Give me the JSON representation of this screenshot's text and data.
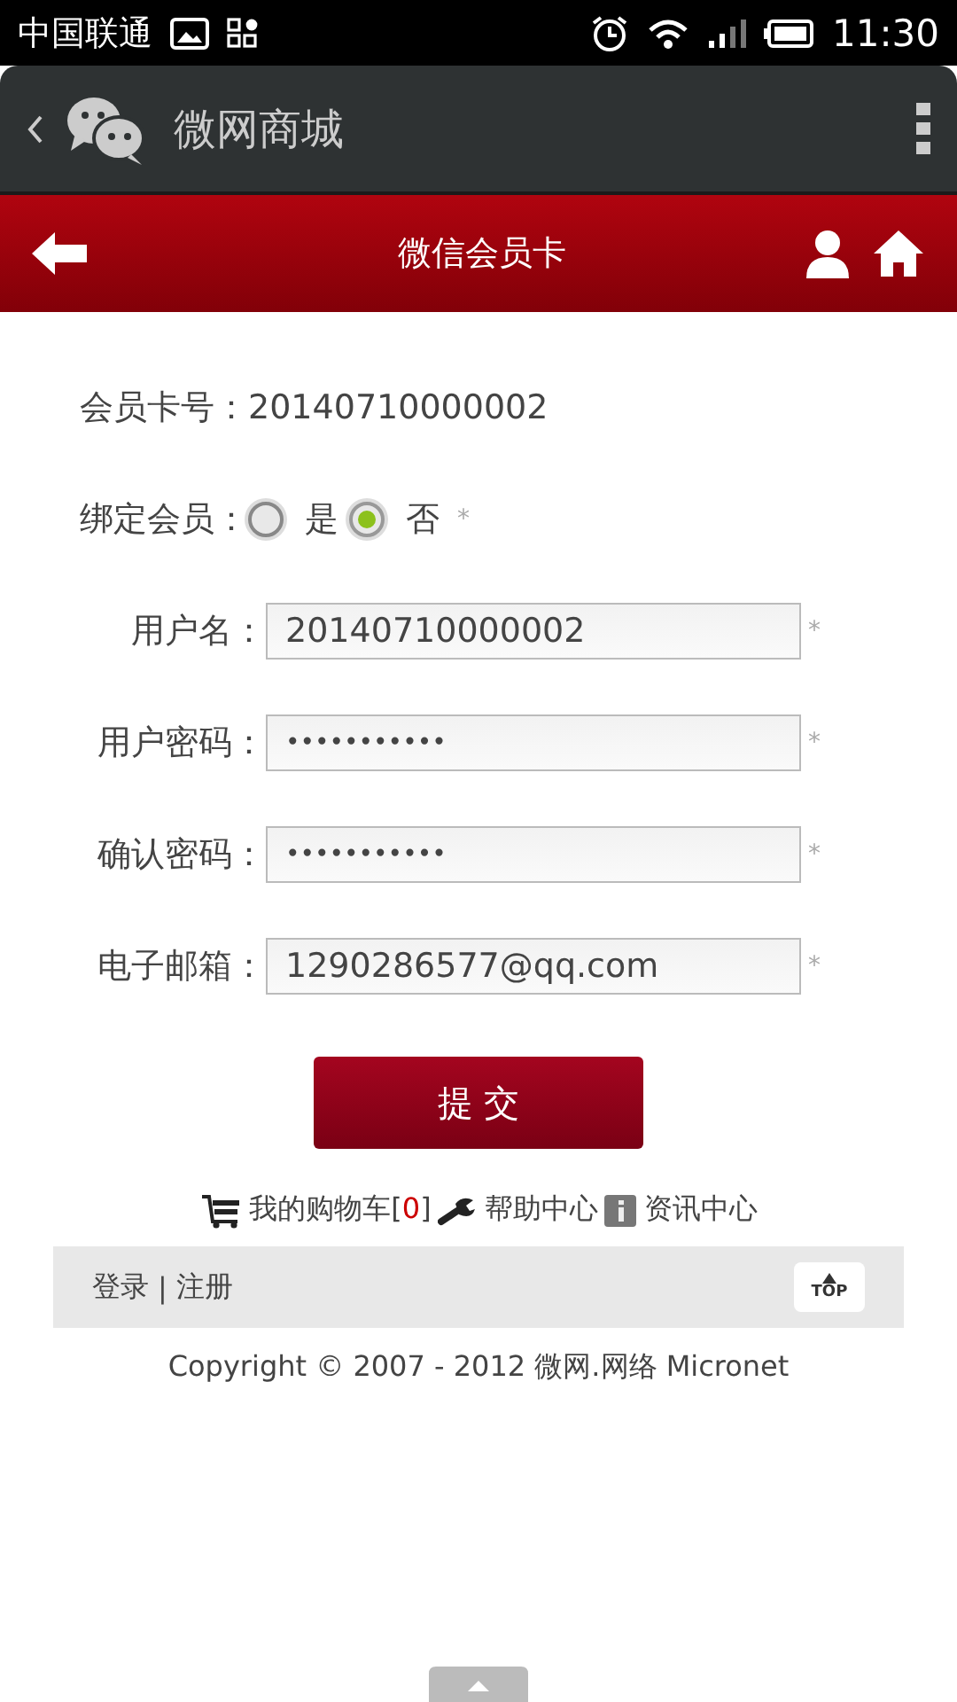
{
  "status_bar": {
    "carrier": "中国联通",
    "time": "11:30"
  },
  "app_bar": {
    "title": "微网商城"
  },
  "header": {
    "title": "微信会员卡"
  },
  "card_number": {
    "label": "会员卡号：",
    "value": "20140710000002"
  },
  "bind_member": {
    "label": "绑定会员：",
    "required": "*",
    "options": [
      {
        "label": "是",
        "selected": false
      },
      {
        "label": "否",
        "selected": true
      }
    ]
  },
  "fields": [
    {
      "label": "用户名：",
      "value": "20140710000002",
      "required": "*",
      "kind": "text"
    },
    {
      "label": "用户密码：",
      "value": "•••••••••••",
      "required": "*",
      "kind": "password"
    },
    {
      "label": "确认密码：",
      "value": "•••••••••••",
      "required": "*",
      "kind": "password"
    },
    {
      "label": "电子邮箱：",
      "value": "1290286577@qq.com",
      "required": "*",
      "kind": "text"
    }
  ],
  "submit": "提 交",
  "links": {
    "cart_prefix": "我的购物车[",
    "cart_count": "0",
    "cart_suffix": "]",
    "help": "帮助中心",
    "news": "资讯中心"
  },
  "footer": {
    "login": "登录",
    "separator": "|",
    "register": "注册",
    "top": "TOP"
  },
  "copyright": "Copyright © 2007 - 2012 微网.网络 Micronet"
}
